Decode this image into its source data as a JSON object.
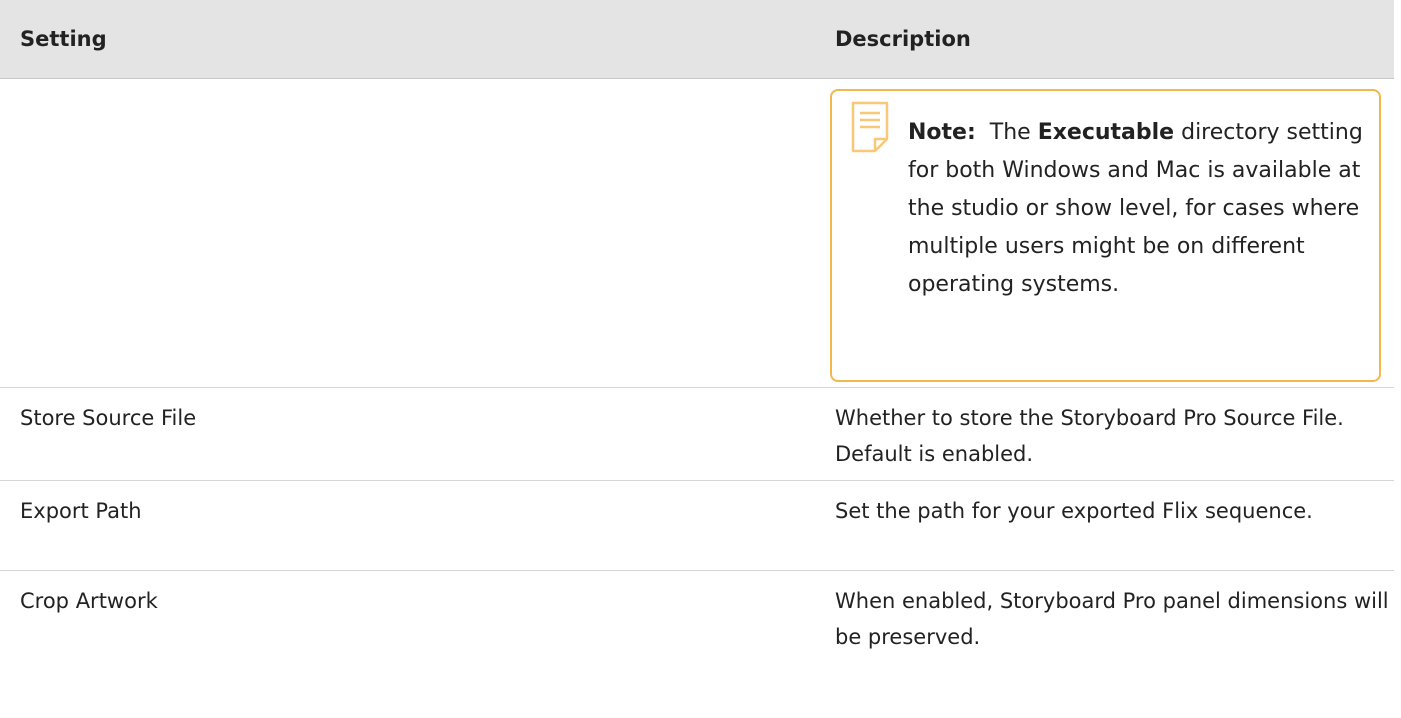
{
  "table": {
    "headers": {
      "setting": "Setting",
      "description": "Description"
    },
    "note": {
      "label": "Note:",
      "pre": "The",
      "bold_term": "Executable",
      "post": "directory setting for both Windows and Mac is available at the studio or show level, for cases where multiple users might be on different operating systems.",
      "icon": "note-icon",
      "border_color": "#f2b94a"
    },
    "rows": [
      {
        "setting": "Store Source File",
        "description": "Whether to store the Storyboard Pro Source File. Default is enabled."
      },
      {
        "setting": "Export Path",
        "description": "Set the path for your exported Flix sequence."
      },
      {
        "setting": "Crop Artwork",
        "description": "When enabled, Storyboard Pro panel dimensions will be preserved."
      }
    ]
  }
}
